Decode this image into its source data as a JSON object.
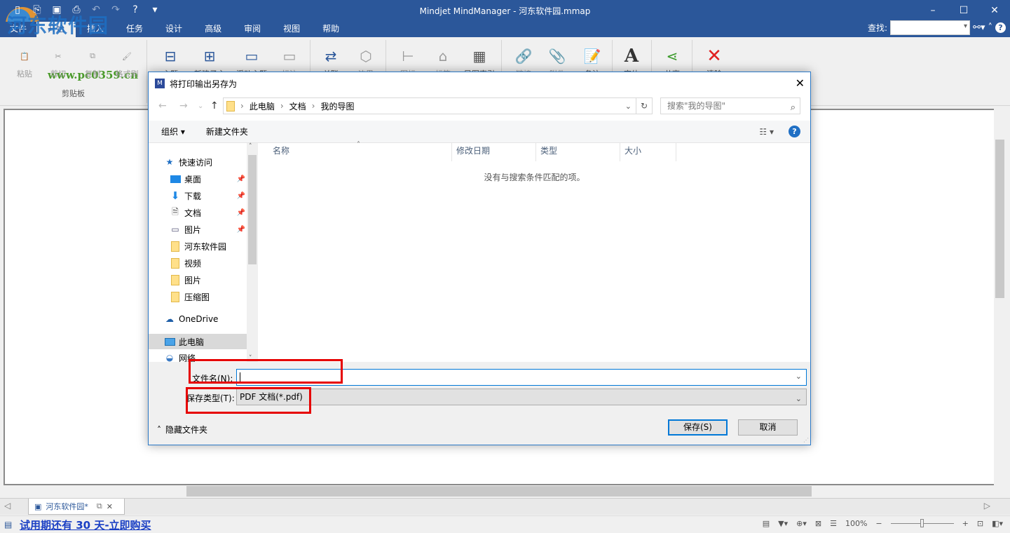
{
  "app": {
    "title": "Mindjet MindManager - 河东软件园.mmap",
    "watermark": "河东软件园",
    "watermark_url": "www.pc0359.cn",
    "accent_color": "#2b579a"
  },
  "quick_access": [
    "new-icon",
    "open-icon",
    "save-icon",
    "print-icon",
    "undo-icon",
    "redo-icon",
    "help-icon",
    "customize-icon"
  ],
  "ribbon_tabs": [
    {
      "label": "文件"
    },
    {
      "label": "开始",
      "active": true
    },
    {
      "label": "插入"
    },
    {
      "label": "任务"
    },
    {
      "label": "设计"
    },
    {
      "label": "高级"
    },
    {
      "label": "审阅"
    },
    {
      "label": "视图"
    },
    {
      "label": "帮助"
    }
  ],
  "find": {
    "label": "查找:",
    "value": ""
  },
  "ribbon": {
    "clipboard_group": "剪贴板",
    "buttons": [
      {
        "label": "粘贴",
        "icon": "paste-icon"
      },
      {
        "label": "剪切",
        "icon": "cut-icon"
      },
      {
        "label": "复制",
        "icon": "copy-icon"
      },
      {
        "label": "格式刷",
        "icon": "format-painter-icon"
      },
      {
        "label": "主题",
        "icon": "topic-icon"
      },
      {
        "label": "新建子主题",
        "icon": "subtopic-icon"
      },
      {
        "label": "浮动主题",
        "icon": "floating-topic-icon"
      },
      {
        "label": "标注",
        "icon": "callout-icon"
      },
      {
        "label": "关联",
        "icon": "relationship-icon"
      },
      {
        "label": "边界",
        "icon": "boundary-icon"
      },
      {
        "label": "图标",
        "icon": "icon-marker-icon"
      },
      {
        "label": "标签",
        "icon": "tag-icon"
      },
      {
        "label": "导图索引",
        "icon": "map-index-icon"
      },
      {
        "label": "链接",
        "icon": "link-icon"
      },
      {
        "label": "附件",
        "icon": "attachment-icon"
      },
      {
        "label": "备注",
        "icon": "notes-icon"
      },
      {
        "label": "字体",
        "icon": "font-icon"
      },
      {
        "label": "共享",
        "icon": "share-icon"
      },
      {
        "label": "清除",
        "icon": "clear-icon"
      }
    ]
  },
  "dialog": {
    "title": "将打印输出另存为",
    "breadcrumb": [
      "此电脑",
      "文档",
      "我的导图"
    ],
    "search_placeholder": "搜索\"我的导图\"",
    "organize": "组织 ▾",
    "new_folder": "新建文件夹",
    "nav": [
      {
        "label": "快速访问",
        "icon": "star-icon"
      },
      {
        "label": "桌面",
        "icon": "desktop-icon",
        "pinned": true
      },
      {
        "label": "下载",
        "icon": "download-icon",
        "pinned": true
      },
      {
        "label": "文档",
        "icon": "document-icon",
        "pinned": true
      },
      {
        "label": "图片",
        "icon": "pictures-icon",
        "pinned": true
      },
      {
        "label": "河东软件园",
        "icon": "folder-icon"
      },
      {
        "label": "视频",
        "icon": "folder-icon"
      },
      {
        "label": "图片",
        "icon": "folder-icon"
      },
      {
        "label": "压缩图",
        "icon": "folder-icon"
      },
      {
        "label": "OneDrive",
        "icon": "cloud-icon"
      },
      {
        "label": "此电脑",
        "icon": "computer-icon",
        "selected": true
      },
      {
        "label": "网络",
        "icon": "network-icon"
      }
    ],
    "columns": [
      "名称",
      "修改日期",
      "类型",
      "大小"
    ],
    "empty_message": "没有与搜索条件匹配的项。",
    "filename_label": "文件名(N):",
    "filename_value": "",
    "filetype_label": "保存类型(T):",
    "filetype_value": "PDF 文档(*.pdf)",
    "hide_folders": "隐藏文件夹",
    "save": "保存(S)",
    "cancel": "取消"
  },
  "doc_tab": {
    "label": "河东软件园*"
  },
  "status": {
    "trial": "试用期还有 30 天-立即购买",
    "zoom": "100%",
    "zoom_level": 0.5
  }
}
